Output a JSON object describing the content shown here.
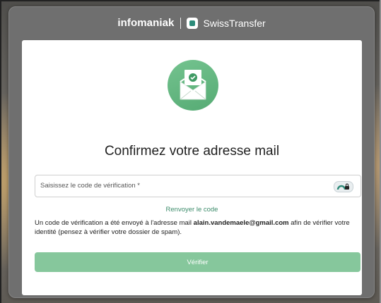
{
  "header": {
    "brand": "infomaniak",
    "product": "SwissTransfer"
  },
  "dialog": {
    "title": "Confirmez votre adresse mail",
    "code_field": {
      "label": "Saisissez le code de vérification *",
      "value": ""
    },
    "resend_link": "Renvoyer le code",
    "info": {
      "before": "Un code de vérification a été envoyé à l'adresse mail ",
      "email": "alain.vandemaele@gmail.com",
      "after": " afin de vérifier votre identité (pensez à vérifier votre dossier de spam)."
    },
    "verify_button": "Vérifier"
  },
  "colors": {
    "accent": "#3d8c6b",
    "button": "#86c79c",
    "illustration": "#62b67f"
  },
  "icons": {
    "illustration": "envelope-check-icon",
    "logo": "swisstransfer-logo-icon",
    "field_addon": "password-manager-icon"
  }
}
